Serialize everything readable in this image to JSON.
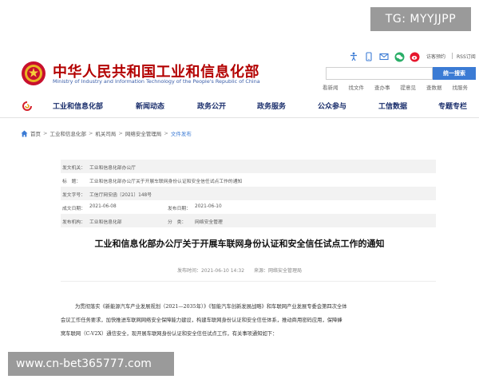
{
  "watermark": {
    "tg": "TG: MYYJJPP",
    "url": "www.cn-bet365777.com"
  },
  "header": {
    "site_name": "中华人民共和国工业和信息化部",
    "site_name_en": "Ministry of Industry and Information Technology of the People's Republic of China",
    "util_icons": [
      "accessibility-icon",
      "mobile-icon",
      "mail-icon",
      "wechat-icon",
      "weibo-icon"
    ],
    "visitor_mode": "访客预约",
    "rss": "RSS订阅",
    "search_placeholder": "",
    "search_button": "统一搜索",
    "quick_links": [
      "看新闻",
      "找文件",
      "查办事",
      "提意见",
      "查数据",
      "找服务"
    ]
  },
  "nav": {
    "items": [
      "工业和信息化部",
      "新闻动态",
      "政务公开",
      "政务服务",
      "公众参与",
      "工信数据",
      "专题专栏"
    ]
  },
  "breadcrumb": [
    "首页",
    "工业和信息化部",
    "机关司局",
    "网络安全管理局",
    "文件发布"
  ],
  "meta": {
    "issuer_label": "发文机关：",
    "issuer": "工业和信息化部办公厅",
    "subject_label": "标　题：",
    "subject": "工业和信息化部办公厅关于开展车联网身份认证和安全信任试点工作的通知",
    "doc_no_label": "发文字号：",
    "doc_no": "工信厅网安函〔2021〕148号",
    "written_label": "成文日期：",
    "written": "2021-06-08",
    "published_label": "发布日期：",
    "published": "2021-06-10",
    "org_label": "发布机构：",
    "org": "工业和信息化部",
    "category_label": "分　类：",
    "category": "网络安全管理"
  },
  "article": {
    "title": "工业和信息化部办公厅关于开展车联网身份认证和安全信任试点工作的通知",
    "meta_line": "发布时间：2021-06-10 14:32　　来源：网络安全管理局",
    "body_lines": [
      "为贯彻落实《新能源汽车产业发展规划（2021—2035年）》《智能汽车创新发展战略》和车联网产业发展专委会第四次全体",
      "会议工作任务要求，加快推进车联网网络安全保障能力建设，构建车联网身份认证和安全信任体系，推动商用密码应用，保障蜂",
      "窝车联网（C-V2X）通信安全，现开展车联网身份认证和安全信任试点工作，有关事项通知如下："
    ]
  },
  "colors": {
    "brand_red": "#b30000",
    "nav_blue": "#1a2e6c",
    "accent_blue": "#3b7bd4"
  }
}
